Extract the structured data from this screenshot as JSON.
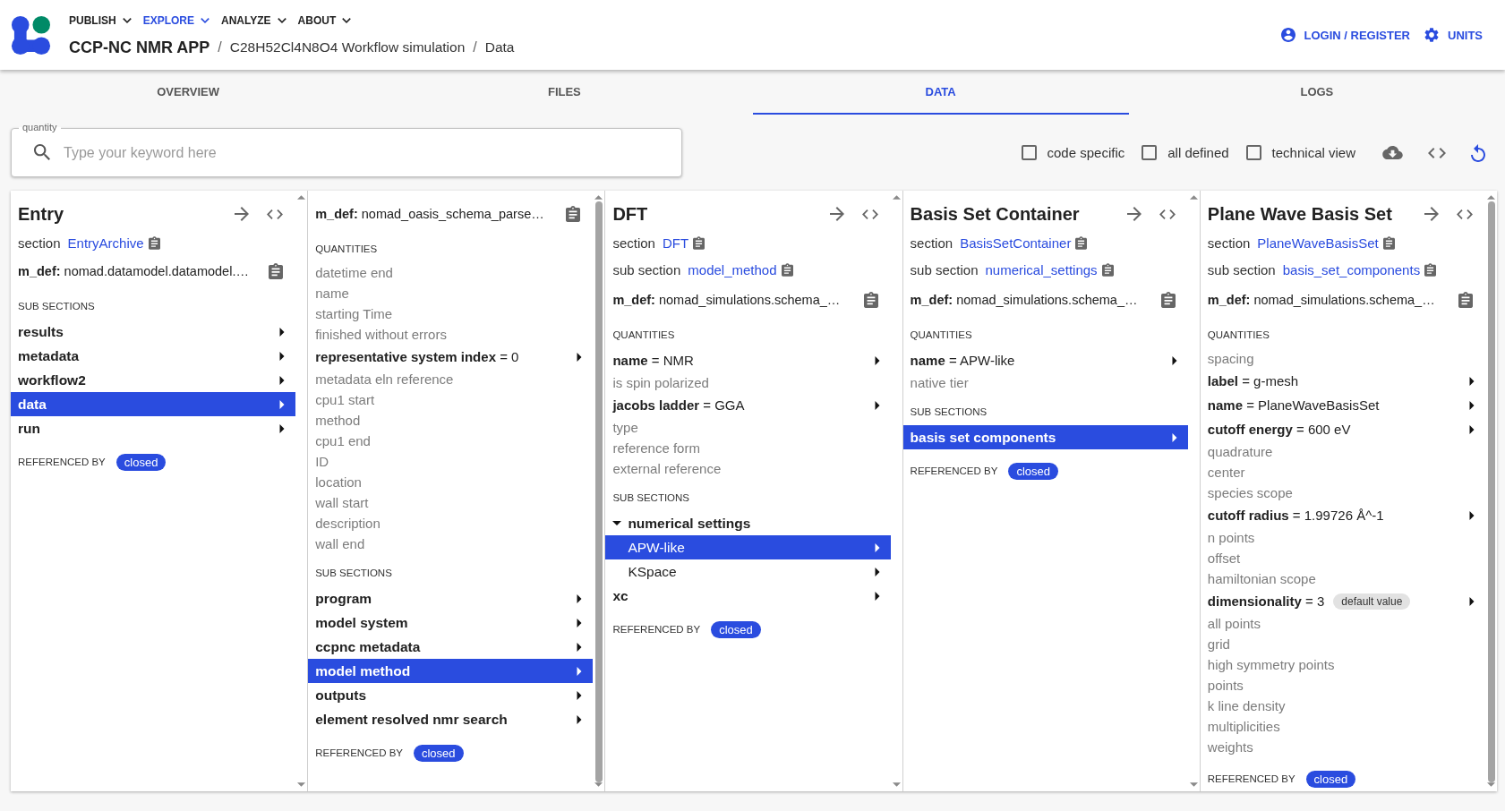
{
  "header": {
    "nav": [
      {
        "label": "PUBLISH",
        "selected": false
      },
      {
        "label": "EXPLORE",
        "selected": true
      },
      {
        "label": "ANALYZE",
        "selected": false
      },
      {
        "label": "ABOUT",
        "selected": false
      }
    ],
    "breadcrumb": {
      "separator": "/",
      "items": [
        "CCP-NC NMR APP",
        "C28H52Cl4N8O4 Workflow simulation",
        "Data"
      ]
    },
    "actions": [
      "LOGIN / REGISTER",
      "UNITS"
    ]
  },
  "tabs": [
    {
      "label": "OVERVIEW",
      "selected": false
    },
    {
      "label": "FILES",
      "selected": false
    },
    {
      "label": "DATA",
      "selected": true
    },
    {
      "label": "LOGS",
      "selected": false
    }
  ],
  "search": {
    "label": "quantity",
    "placeholder": "Type your keyword here"
  },
  "options": [
    {
      "label": "code specific",
      "checked": false
    },
    {
      "label": "all defined",
      "checked": false
    },
    {
      "label": "technical view",
      "checked": false
    }
  ],
  "columns": [
    {
      "title": "Entry",
      "meta": [
        {
          "label": "section",
          "link": "EntryArchive"
        }
      ],
      "definition": "**m_def:** nomad.datamodel.datamodel.…",
      "scrollable": false,
      "groups": [
        {
          "kind": "subsections",
          "heading": "SUB SECTIONS",
          "items": [
            {
              "name": "results",
              "selected": false
            },
            {
              "name": "metadata",
              "selected": false
            },
            {
              "name": "workflow2",
              "selected": false
            },
            {
              "name": "data",
              "selected": true
            },
            {
              "name": "run",
              "selected": false
            }
          ]
        }
      ],
      "referenced": {
        "label": "REFERENCED BY",
        "chip": "closed"
      }
    },
    {
      "definition": "**m_def:** nomad_oasis_schema_parse…",
      "scrollable": true,
      "groups": [
        {
          "kind": "quantities",
          "heading": "QUANTITIES",
          "items": [
            {
              "text": "datetime end",
              "defined": false
            },
            {
              "text": "name",
              "defined": false
            },
            {
              "text": "starting Time",
              "defined": false
            },
            {
              "text": "finished without errors",
              "defined": false
            },
            {
              "text": "**representative system index** = 0",
              "defined": true
            },
            {
              "text": "metadata eln reference",
              "defined": false
            },
            {
              "text": "cpu1 start",
              "defined": false
            },
            {
              "text": "method",
              "defined": false
            },
            {
              "text": "cpu1 end",
              "defined": false
            },
            {
              "text": "ID",
              "defined": false
            },
            {
              "text": "location",
              "defined": false
            },
            {
              "text": "wall start",
              "defined": false
            },
            {
              "text": "description",
              "defined": false
            },
            {
              "text": "wall end",
              "defined": false
            }
          ]
        },
        {
          "kind": "subsections",
          "heading": "SUB SECTIONS",
          "items": [
            {
              "name": "program",
              "selected": false
            },
            {
              "name": "model system",
              "selected": false
            },
            {
              "name": "ccpnc metadata",
              "selected": false
            },
            {
              "name": "model method",
              "selected": true
            },
            {
              "name": "outputs",
              "selected": false
            },
            {
              "name": "element resolved nmr search",
              "selected": false
            }
          ]
        }
      ],
      "referenced": {
        "label": "REFERENCED BY",
        "chip": "closed"
      }
    },
    {
      "title": "DFT",
      "meta": [
        {
          "label": "section",
          "link": "DFT"
        },
        {
          "label": "sub section",
          "link": "model_method"
        }
      ],
      "definition": "**m_def:** nomad_simulations.schema_…",
      "scrollable": false,
      "groups": [
        {
          "kind": "quantities",
          "heading": "QUANTITIES",
          "items": [
            {
              "text": "**name** = NMR",
              "defined": true
            },
            {
              "text": "is spin polarized",
              "defined": false
            },
            {
              "text": "**jacobs ladder** = GGA",
              "defined": true
            },
            {
              "text": "type",
              "defined": false
            },
            {
              "text": "reference form",
              "defined": false
            },
            {
              "text": "external reference",
              "defined": false
            }
          ]
        },
        {
          "kind": "subsections",
          "heading": "SUB SECTIONS",
          "items": [
            {
              "name": "numerical settings",
              "selected": false,
              "expanded": true,
              "children": [
                {
                  "name": "APW-like",
                  "selected": true
                },
                {
                  "name": "KSpace",
                  "selected": false
                }
              ]
            },
            {
              "name": "xc",
              "selected": false,
              "expanded": false
            }
          ]
        }
      ],
      "referenced": {
        "label": "REFERENCED BY",
        "chip": "closed"
      }
    },
    {
      "title": "Basis Set Container",
      "meta": [
        {
          "label": "section",
          "link": "BasisSetContainer"
        },
        {
          "label": "sub section",
          "link": "numerical_settings"
        }
      ],
      "definition": "**m_def:** nomad_simulations.schema_…",
      "scrollable": false,
      "groups": [
        {
          "kind": "quantities",
          "heading": "QUANTITIES",
          "items": [
            {
              "text": "**name** = APW-like",
              "defined": true
            },
            {
              "text": "native tier",
              "defined": false
            }
          ]
        },
        {
          "kind": "subsections",
          "heading": "SUB SECTIONS",
          "items": [
            {
              "name": "basis set components",
              "selected": true
            }
          ]
        }
      ],
      "referenced": {
        "label": "REFERENCED BY",
        "chip": "closed"
      }
    },
    {
      "title": "Plane Wave Basis Set",
      "meta": [
        {
          "label": "section",
          "link": "PlaneWaveBasisSet"
        },
        {
          "label": "sub section",
          "link": "basis_set_components"
        }
      ],
      "definition": "**m_def:** nomad_simulations.schema_…",
      "scrollable": true,
      "groups": [
        {
          "kind": "quantities",
          "heading": "QUANTITIES",
          "items": [
            {
              "text": "spacing",
              "defined": false
            },
            {
              "text": "**label** = g-mesh",
              "defined": true
            },
            {
              "text": "**name** = PlaneWaveBasisSet",
              "defined": true
            },
            {
              "text": "**cutoff energy** = 600 eV",
              "defined": true
            },
            {
              "text": "quadrature",
              "defined": false
            },
            {
              "text": "center",
              "defined": false
            },
            {
              "text": "species scope",
              "defined": false
            },
            {
              "text": "**cutoff radius** = 1.99726 Å^-1",
              "defined": true
            },
            {
              "text": "n points",
              "defined": false
            },
            {
              "text": "offset",
              "defined": false
            },
            {
              "text": "hamiltonian scope",
              "defined": false
            },
            {
              "text": "**dimensionality** = 3",
              "defined": true,
              "badge": "default value"
            },
            {
              "text": "all points",
              "defined": false
            },
            {
              "text": "grid",
              "defined": false
            },
            {
              "text": "high symmetry points",
              "defined": false
            },
            {
              "text": "points",
              "defined": false
            },
            {
              "text": "k line density",
              "defined": false
            },
            {
              "text": "multiplicities",
              "defined": false
            },
            {
              "text": "weights",
              "defined": false
            }
          ]
        }
      ],
      "referenced": {
        "label": "REFERENCED BY",
        "chip": "closed"
      }
    }
  ]
}
